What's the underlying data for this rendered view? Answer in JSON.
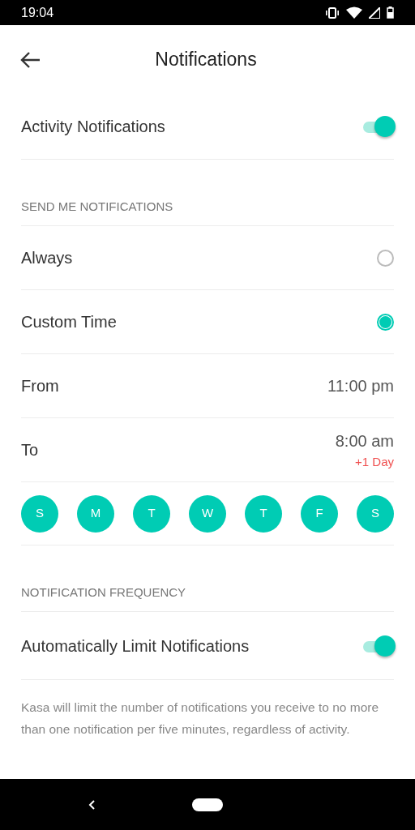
{
  "status_bar": {
    "time": "19:04"
  },
  "header": {
    "title": "Notifications"
  },
  "activity": {
    "label": "Activity Notifications",
    "on": true
  },
  "send_section": {
    "heading": "SEND ME NOTIFICATIONS"
  },
  "options": [
    {
      "label": "Always",
      "selected": false
    },
    {
      "label": "Custom Time",
      "selected": true
    }
  ],
  "from": {
    "label": "From",
    "value": "11:00 pm"
  },
  "to": {
    "label": "To",
    "value": "8:00 am",
    "note": "+1 Day"
  },
  "days": [
    {
      "label": "S",
      "selected": true
    },
    {
      "label": "M",
      "selected": true
    },
    {
      "label": "T",
      "selected": true
    },
    {
      "label": "W",
      "selected": true
    },
    {
      "label": "T",
      "selected": true
    },
    {
      "label": "F",
      "selected": true
    },
    {
      "label": "S",
      "selected": true
    }
  ],
  "frequency_section": {
    "heading": "NOTIFICATION FREQUENCY"
  },
  "auto_limit": {
    "label": "Automatically Limit Notifications",
    "on": true
  },
  "description": "Kasa will limit the number of notifications you receive to no more than one notification per five minutes, regardless of activity."
}
